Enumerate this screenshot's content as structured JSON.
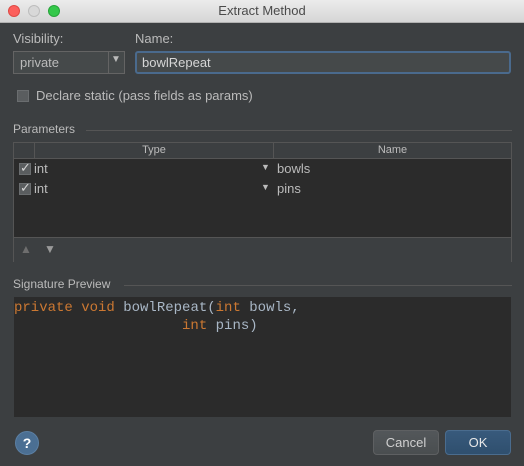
{
  "window": {
    "title": "Extract Method"
  },
  "visibility": {
    "label": "Visibility:",
    "selected": "private"
  },
  "name": {
    "label": "Name:",
    "value": "bowlRepeat"
  },
  "declare_static": {
    "label": "Declare static (pass fields as params)",
    "checked": false
  },
  "parameters": {
    "section_label": "Parameters",
    "columns": [
      "Type",
      "Name"
    ],
    "rows": [
      {
        "checked": true,
        "type": "int",
        "name": "bowls"
      },
      {
        "checked": true,
        "type": "int",
        "name": "pins"
      }
    ],
    "toolbar": {
      "move_up": "move-up-icon",
      "move_down": "move-down-icon"
    }
  },
  "signature": {
    "section_label": "Signature Preview",
    "line1": {
      "modifiers": "private void",
      "method": " bowlRepeat(",
      "type": "int",
      "param": " bowls,"
    },
    "line2": {
      "indent": "                    ",
      "type": "int",
      "param": " pins)"
    }
  },
  "buttons": {
    "help": "?",
    "cancel": "Cancel",
    "ok": "OK"
  },
  "colors": {
    "background": "#3c3f41",
    "keyword": "#cc7832",
    "code": "#a9b7c6",
    "accent": "#4a6a8d"
  }
}
